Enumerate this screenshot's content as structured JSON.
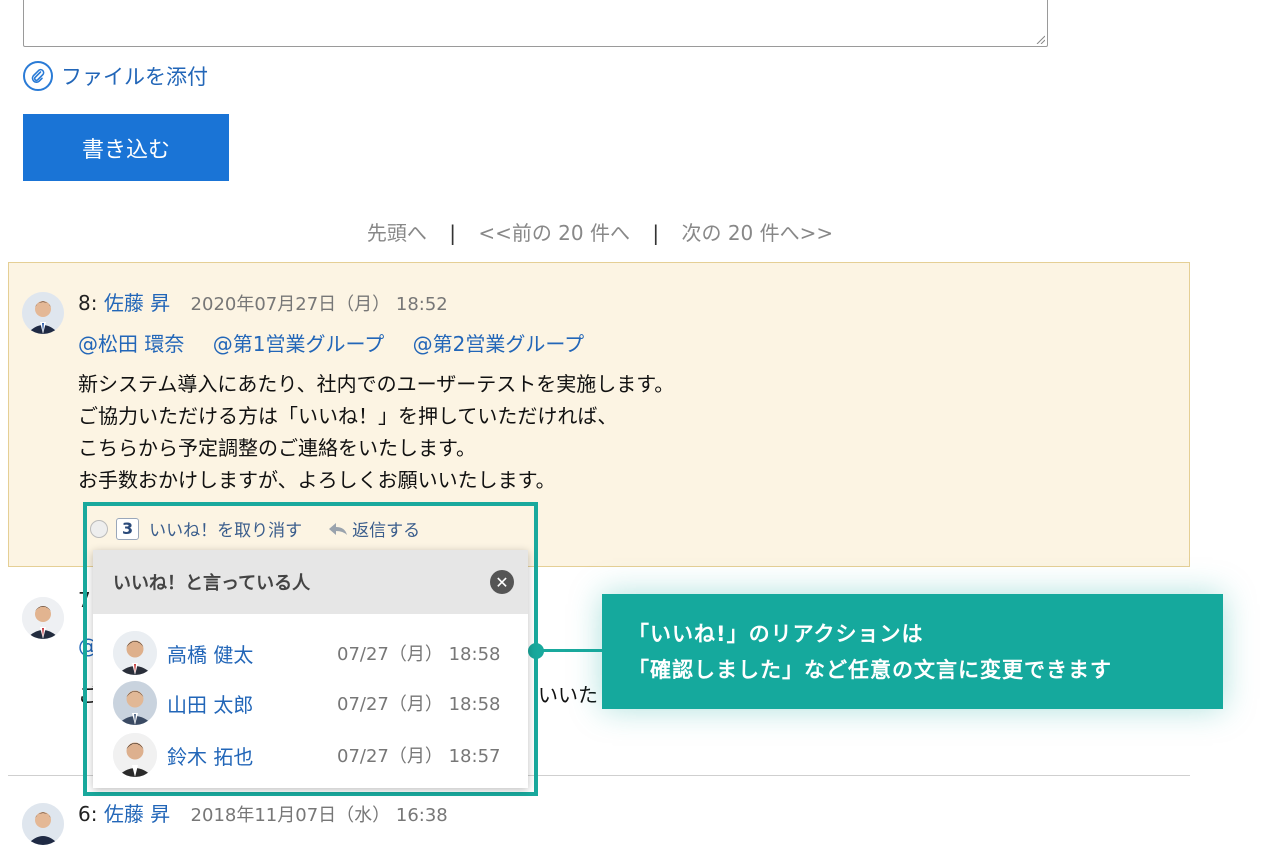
{
  "composer": {
    "attach_label": "ファイルを添付",
    "submit_label": "書き込む"
  },
  "pager": {
    "first": "先頭へ",
    "prev": "<<前の 20 件へ",
    "next": "次の 20 件へ>>",
    "separator": "|"
  },
  "posts": [
    {
      "number": "8:",
      "author": "佐藤 昇",
      "date": "2020年07月27日（月） 18:52",
      "mentions": [
        "@松田 環奈",
        "@第1営業グループ",
        "@第2営業グループ"
      ],
      "lines": [
        "新システム導入にあたり、社内でのユーザーテストを実施します。",
        "ご協力いただける方は「いいね！」を押していただければ、",
        "こちらから予定調整のご連絡をいたします。",
        "お手数おかけしますが、よろしくお願いいたします。"
      ],
      "like_count": "3",
      "unlike_label": "いいね！を取り消す",
      "reply_label": "返信する"
    },
    {
      "number": "7",
      "mention_fragment": "@",
      "text_fragment": "ご",
      "text_tail": "いいた"
    },
    {
      "number": "6:",
      "author": "佐藤 昇",
      "date": "2018年11月07日（水） 16:38"
    }
  ],
  "likes_popup": {
    "title": "いいね！と言っている人",
    "likers": [
      {
        "name": "高橋 健太",
        "time": "07/27（月） 18:58"
      },
      {
        "name": "山田 太郎",
        "time": "07/27（月） 18:58"
      },
      {
        "name": "鈴木 拓也",
        "time": "07/27（月） 18:57"
      }
    ]
  },
  "callout": {
    "line1": "「いいね!」のリアクションは",
    "line2": "「確認しました」など任意の文言に変更できます"
  },
  "colors": {
    "accent": "#15a99d",
    "link": "#2266b8",
    "button": "#1a74d6",
    "post_bg": "#fcf4e3"
  }
}
